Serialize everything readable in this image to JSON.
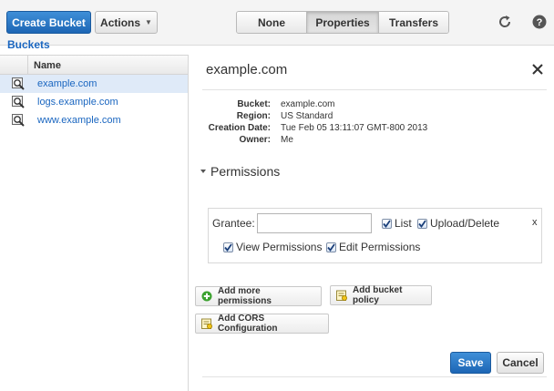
{
  "toolbar": {
    "create_bucket_label": "Create Bucket",
    "actions_label": "Actions",
    "view_tabs": [
      {
        "label": "None",
        "active": false
      },
      {
        "label": "Properties",
        "active": true
      },
      {
        "label": "Transfers",
        "active": false
      }
    ],
    "refresh_icon": "refresh-icon",
    "help_icon": "help-icon"
  },
  "breadcrumb": {
    "buckets_label": "Buckets"
  },
  "bucket_list": {
    "column_header": "Name",
    "items": [
      {
        "name": "example.com",
        "selected": true,
        "icon": "bucket-magnifier-icon"
      },
      {
        "name": "logs.example.com",
        "selected": false,
        "icon": "bucket-magnifier-icon"
      },
      {
        "name": "www.example.com",
        "selected": false,
        "icon": "bucket-magnifier-icon"
      }
    ]
  },
  "properties": {
    "title": "example.com",
    "fields": [
      {
        "label": "Bucket:",
        "value": "example.com"
      },
      {
        "label": "Region:",
        "value": "US Standard"
      },
      {
        "label": "Creation Date:",
        "value": "Tue Feb 05 13:11:07 GMT-800 2013"
      },
      {
        "label": "Owner:",
        "value": "Me"
      }
    ]
  },
  "permissions": {
    "title": "Permissions",
    "grantee_label": "Grantee:",
    "grantee_value": "",
    "checkboxes": {
      "list": {
        "label": "List",
        "checked": true
      },
      "upload_delete": {
        "label": "Upload/Delete",
        "checked": true
      },
      "view_permissions": {
        "label": "View Permissions",
        "checked": true
      },
      "edit_permissions": {
        "label": "Edit Permissions",
        "checked": true
      }
    },
    "remove_label": "x",
    "add_more_label": "Add more permissions",
    "add_policy_label": "Add bucket policy",
    "add_cors_label": "Add CORS Configuration"
  },
  "footer": {
    "save_label": "Save",
    "cancel_label": "Cancel"
  },
  "colors": {
    "primary": "#1d66b5",
    "link": "#1a66c0",
    "selected_row": "#dfeaf8",
    "add_icon": "#3aa12e"
  }
}
